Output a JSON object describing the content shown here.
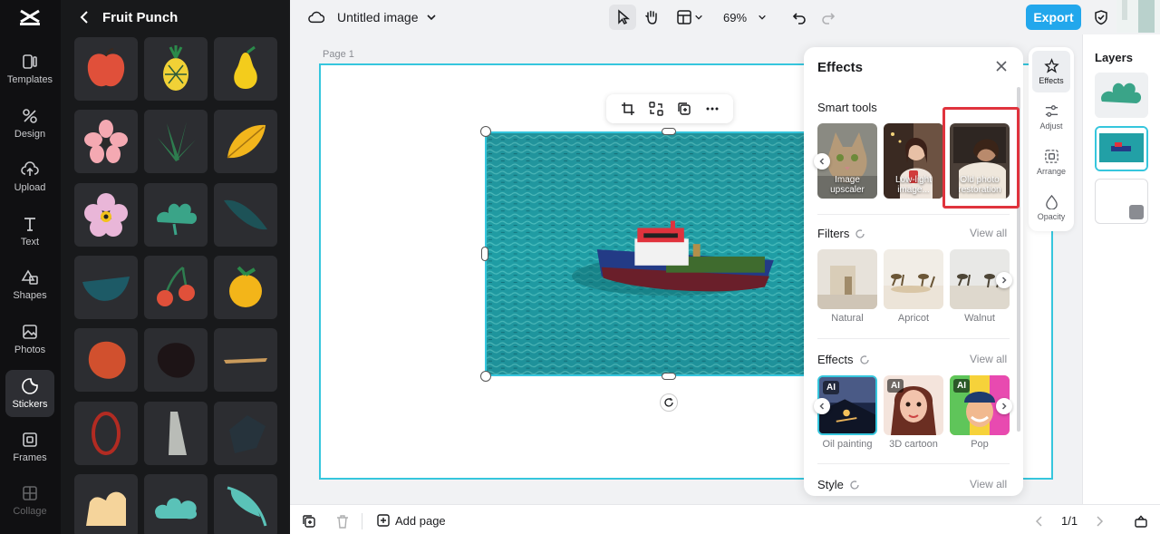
{
  "app": {
    "title": "Untitled image",
    "zoom": "69%",
    "export_label": "Export"
  },
  "rail": {
    "items": [
      {
        "label": "Templates",
        "icon": "templates-icon"
      },
      {
        "label": "Design",
        "icon": "design-icon"
      },
      {
        "label": "Upload",
        "icon": "upload-icon"
      },
      {
        "label": "Text",
        "icon": "text-icon"
      },
      {
        "label": "Shapes",
        "icon": "shapes-icon"
      },
      {
        "label": "Photos",
        "icon": "photos-icon"
      },
      {
        "label": "Stickers",
        "icon": "stickers-icon",
        "active": true
      },
      {
        "label": "Frames",
        "icon": "frames-icon"
      },
      {
        "label": "Collage",
        "icon": "collage-icon"
      }
    ]
  },
  "sticker_panel": {
    "title": "Fruit Punch",
    "stickers": [
      "red apple",
      "pineapple",
      "yellow pear",
      "pink flower",
      "green leaves",
      "yellow leaf",
      "purple flower",
      "green bush",
      "teal leaf",
      "teal bowl",
      "cherries",
      "orange",
      "red blob",
      "dark blob",
      "brush stroke",
      "red ring",
      "gray shard",
      "dark shape",
      "cream shape",
      "teal cloud",
      "teal leaf stem"
    ]
  },
  "canvas": {
    "page_label": "Page 1"
  },
  "effects_panel": {
    "title": "Effects",
    "smart_tools": {
      "title": "Smart tools",
      "items": [
        "Image upscaler",
        "Low-light image...",
        "Old photo restoration"
      ]
    },
    "filters": {
      "title": "Filters",
      "view_all": "View all",
      "items": [
        "Natural",
        "Apricot",
        "Walnut"
      ]
    },
    "effects": {
      "title": "Effects",
      "view_all": "View all",
      "ai_badge": "AI",
      "items": [
        "Oil painting",
        "3D cartoon",
        "Pop"
      ]
    },
    "style": {
      "title": "Style",
      "view_all": "View all"
    }
  },
  "tools": {
    "items": [
      {
        "label": "Effects",
        "active": true
      },
      {
        "label": "Adjust"
      },
      {
        "label": "Arrange"
      },
      {
        "label": "Opacity"
      }
    ]
  },
  "layers": {
    "title": "Layers"
  },
  "bottom": {
    "add_page": "Add page",
    "page_count": "1/1"
  },
  "colors": {
    "accent": "#22a7ec",
    "selection": "#36c6dd",
    "highlight": "#e0333d"
  }
}
